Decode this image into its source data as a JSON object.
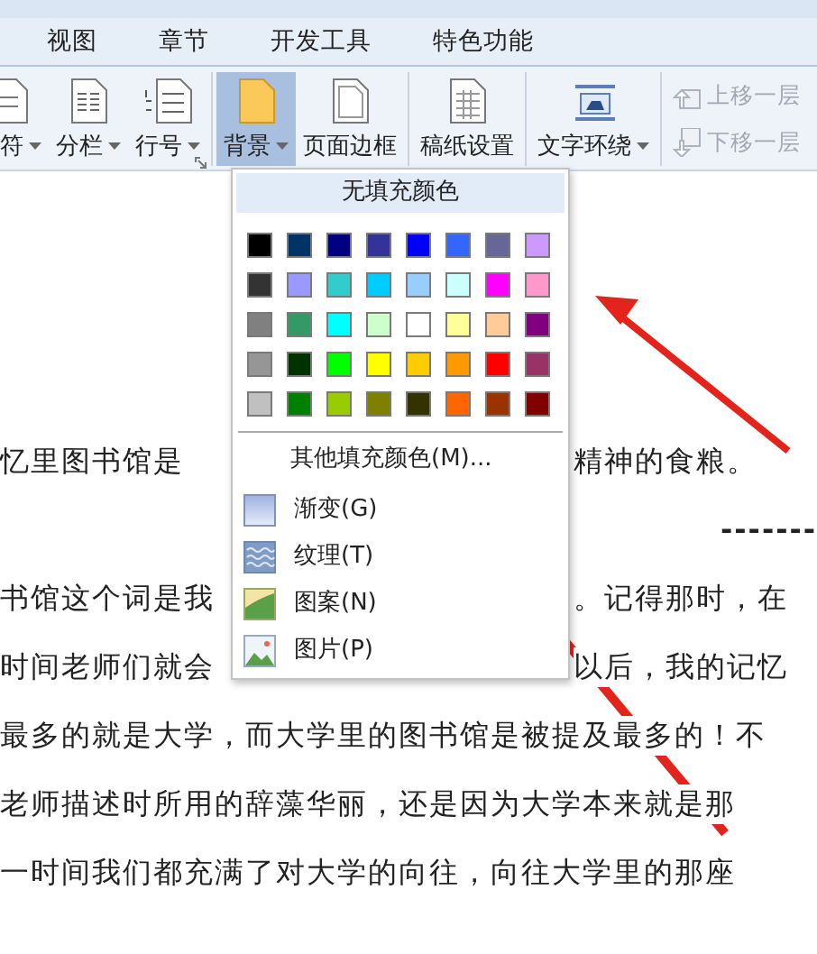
{
  "tabs": [
    {
      "label": "视图",
      "selected": false
    },
    {
      "label": "章节",
      "selected": false
    },
    {
      "label": "开发工具",
      "selected": false
    },
    {
      "label": "特色功能",
      "selected": false
    }
  ],
  "ribbon": {
    "groups": [
      {
        "buttons": [
          {
            "label": "符",
            "has_menu": true,
            "selected": false
          },
          {
            "label": "分栏",
            "has_menu": true,
            "selected": false
          },
          {
            "label": "行号",
            "has_menu": true,
            "selected": false
          }
        ]
      },
      {
        "buttons": [
          {
            "label": "背景",
            "has_menu": true,
            "selected": true
          },
          {
            "label": "页面边框",
            "has_menu": false,
            "selected": false
          }
        ]
      },
      {
        "buttons": [
          {
            "label": "稿纸设置",
            "has_menu": false,
            "selected": false
          }
        ]
      },
      {
        "buttons": [
          {
            "label": "文字环绕",
            "has_menu": true,
            "selected": false
          }
        ]
      }
    ],
    "small_buttons": [
      {
        "label": "上移一层",
        "disabled": true
      },
      {
        "label": "下移一层",
        "disabled": true
      }
    ]
  },
  "fill_menu": {
    "header": "无填充颜色",
    "swatch_rows": [
      [
        {
          "color": "#000000"
        },
        {
          "color": "#003366"
        },
        {
          "color": "#000080"
        },
        {
          "color": "#333399"
        },
        {
          "color": "#0000ff"
        },
        {
          "color": "#3366ff"
        },
        {
          "color": "#666699"
        },
        {
          "color": "#cc99ff"
        }
      ],
      [
        {
          "color": "#333333"
        },
        {
          "color": "#9999ff"
        },
        {
          "color": "#33cccc"
        },
        {
          "color": "#00ccff"
        },
        {
          "color": "#99ccff"
        },
        {
          "color": "#ccffff"
        },
        {
          "color": "#ff00ff"
        },
        {
          "color": "#ff99cc"
        }
      ],
      [
        {
          "color": "#808080"
        },
        {
          "color": "#339966"
        },
        {
          "color": "#00ffff"
        },
        {
          "color": "#ccffcc"
        },
        {
          "color": "#ffffff"
        },
        {
          "color": "#ffff99"
        },
        {
          "color": "#ffcc99"
        },
        {
          "color": "#800080"
        }
      ],
      [
        {
          "color": "#969696"
        },
        {
          "color": "#003300"
        },
        {
          "color": "#00ff00"
        },
        {
          "color": "#ffff00"
        },
        {
          "color": "#ffcc00"
        },
        {
          "color": "#ff9900"
        },
        {
          "color": "#ff0000"
        },
        {
          "color": "#993366"
        }
      ],
      [
        {
          "color": "#c0c0c0"
        },
        {
          "color": "#008000"
        },
        {
          "color": "#99cc00"
        },
        {
          "color": "#808000"
        },
        {
          "color": "#333300"
        },
        {
          "color": "#ff6600"
        },
        {
          "color": "#993300"
        },
        {
          "color": "#800000"
        }
      ]
    ],
    "items": [
      {
        "label": "其他填充颜色(M)...",
        "kind": "more"
      },
      {
        "label": "渐变(G)",
        "kind": "gradient"
      },
      {
        "label": "纹理(T)",
        "kind": "texture"
      },
      {
        "label": "图案(N)",
        "kind": "pattern"
      },
      {
        "label": "图片(P)",
        "kind": "picture"
      }
    ]
  },
  "document": {
    "lines": [
      {
        "kind": "text",
        "left": "忆里图书馆是",
        "right": "精神的食粮。"
      },
      {
        "kind": "rule",
        "right": "-------"
      },
      {
        "kind": "text",
        "left": "书馆这个词是我",
        "right": "。记得那时，在"
      },
      {
        "kind": "text",
        "left": "时间老师们就会",
        "right": "以后，我的记忆"
      },
      {
        "kind": "text",
        "left": "最多的就是大学，而大学里的图书馆是被提及最多的！不"
      },
      {
        "kind": "text",
        "left": "老师描述时所用的辞藻华丽，还是因为大学本来就是那"
      },
      {
        "kind": "text",
        "left": "一时间我们都充满了对大学的向往，向往大学里的那座"
      }
    ]
  }
}
